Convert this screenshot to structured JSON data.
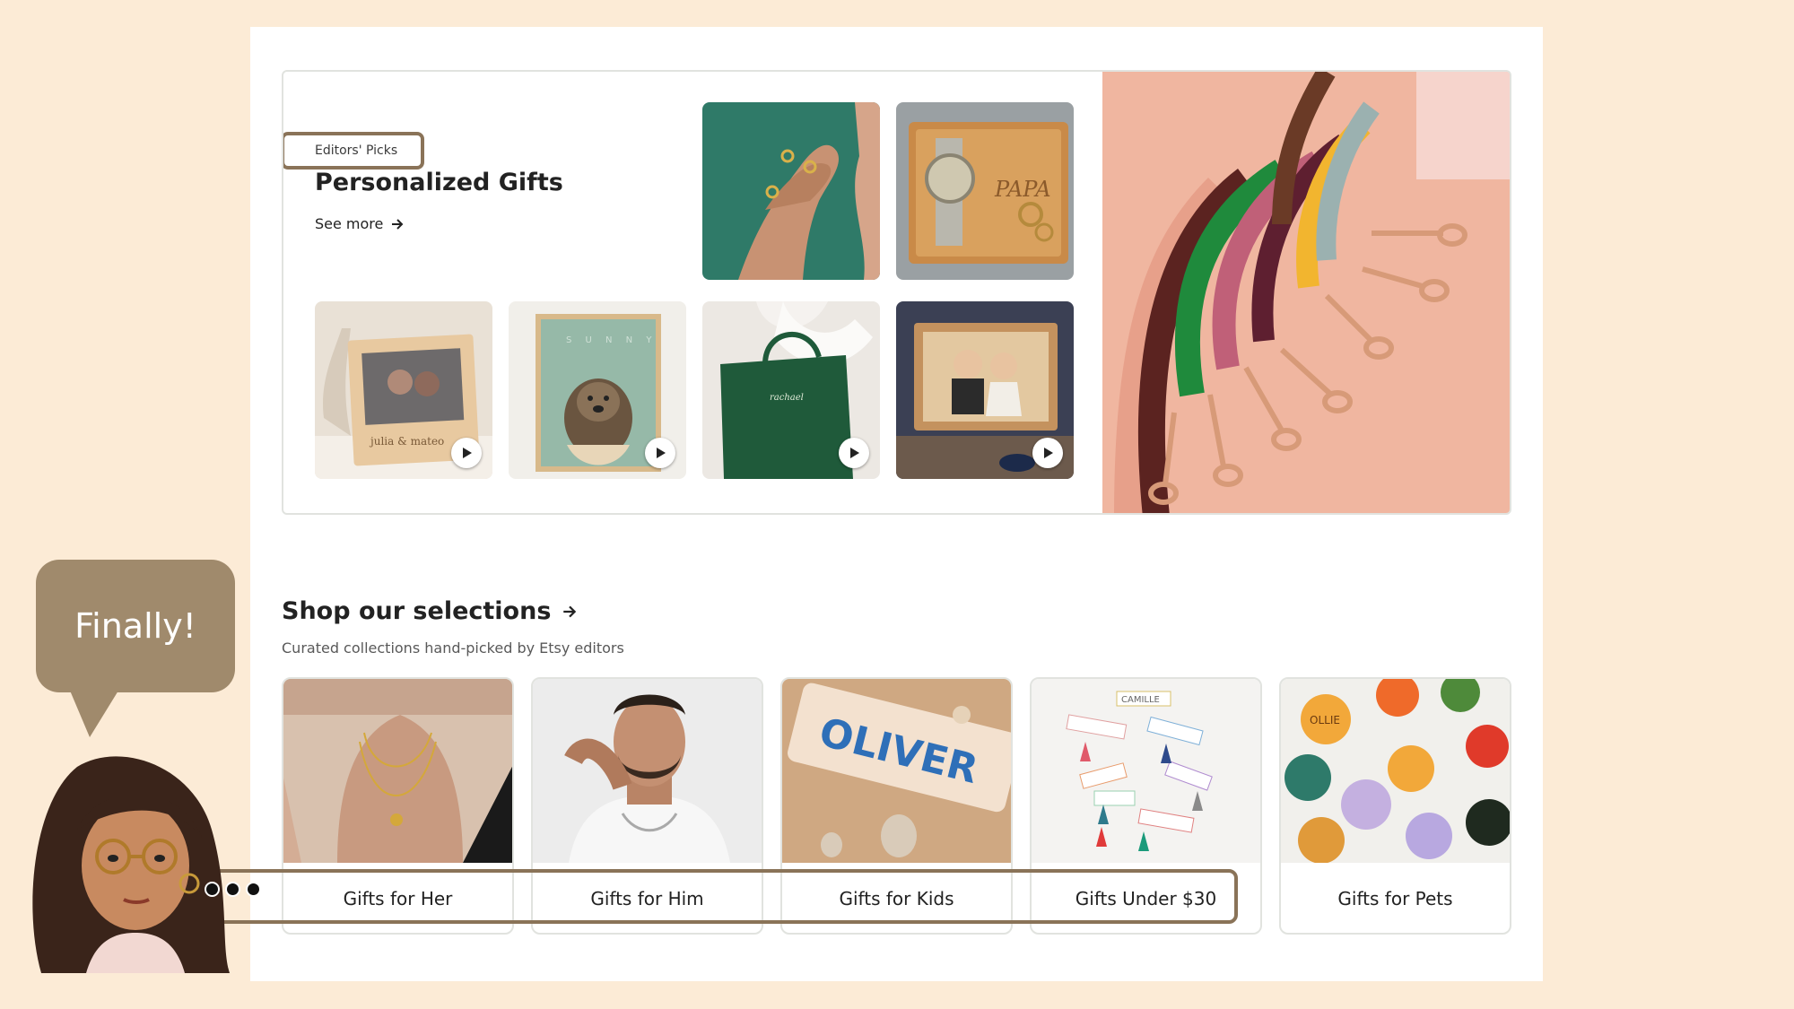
{
  "editors_picks": {
    "eyebrow": "Editors' Picks",
    "title": "Personalized Gifts",
    "see_more": "See more",
    "thumbs": [
      {
        "name": "rings-hands-image",
        "video": false
      },
      {
        "name": "engraved-watch-tray-image",
        "video": false
      },
      {
        "name": "photo-frame-image",
        "video": true,
        "engraving": "julia & mateo"
      },
      {
        "name": "dog-portrait-image",
        "video": true,
        "engraving": "S U N N Y"
      },
      {
        "name": "tote-bag-image",
        "video": true,
        "engraving": "rachael"
      },
      {
        "name": "wooden-couple-frame-image",
        "video": true
      }
    ],
    "hero": "leather-leashes-image"
  },
  "selections": {
    "title": "Shop our selections",
    "subtitle": "Curated collections hand-picked by Etsy editors",
    "tiles": [
      {
        "label": "Gifts for Her"
      },
      {
        "label": "Gifts for Him"
      },
      {
        "label": "Gifts for Kids",
        "image_text": "OLIVER"
      },
      {
        "label": "Gifts Under $30",
        "image_text": "CAMILLE"
      },
      {
        "label": "Gifts for Pets",
        "image_text": "OLLIE"
      }
    ]
  },
  "bitmoji": {
    "bubble_text": "Finally!"
  },
  "colors": {
    "page_background": "#fcebd6",
    "callout": "#8a7358",
    "bubble": "#a08a6c"
  }
}
